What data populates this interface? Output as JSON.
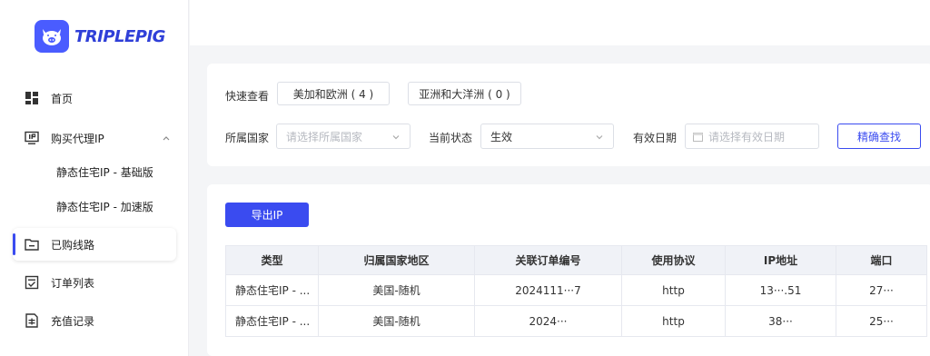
{
  "brand": {
    "name": "TRIPLEPIG",
    "logo_icon": "pig-icon",
    "accent": "#3a4bf0"
  },
  "sidebar": {
    "items": [
      {
        "label": "首页",
        "icon": "dashboard-icon"
      },
      {
        "label": "购买代理IP",
        "icon": "monitor-ip-icon",
        "expanded": true
      },
      {
        "label": "已购线路",
        "icon": "folder-icon",
        "active": true
      },
      {
        "label": "订单列表",
        "icon": "checklist-icon"
      },
      {
        "label": "充值记录",
        "icon": "receipt-icon"
      }
    ],
    "submenu": [
      {
        "label": "静态住宅IP - 基础版"
      },
      {
        "label": "静态住宅IP - 加速版"
      }
    ]
  },
  "filters": {
    "quick_view_label": "快速查看",
    "quick_buttons": [
      "美加和欧洲 ( 4 )",
      "亚洲和大洋洲 ( 0 )"
    ],
    "country_label": "所属国家",
    "country_placeholder": "请选择所属国家",
    "status_label": "当前状态",
    "status_value": "生效",
    "date_label": "有效日期",
    "date_placeholder": "请选择有效日期",
    "search_button": "精确查找"
  },
  "table": {
    "export_button": "导出IP",
    "headers": [
      "类型",
      "归属国家地区",
      "关联订单编号",
      "使用协议",
      "IP地址",
      "端口"
    ],
    "rows": [
      [
        "静态住宅IP - ...",
        "美国-随机",
        "2024111···7",
        "http",
        "13···.51",
        "27···"
      ],
      [
        "静态住宅IP - ...",
        "美国-随机",
        "2024···",
        "http",
        "38···",
        "25···"
      ]
    ]
  }
}
